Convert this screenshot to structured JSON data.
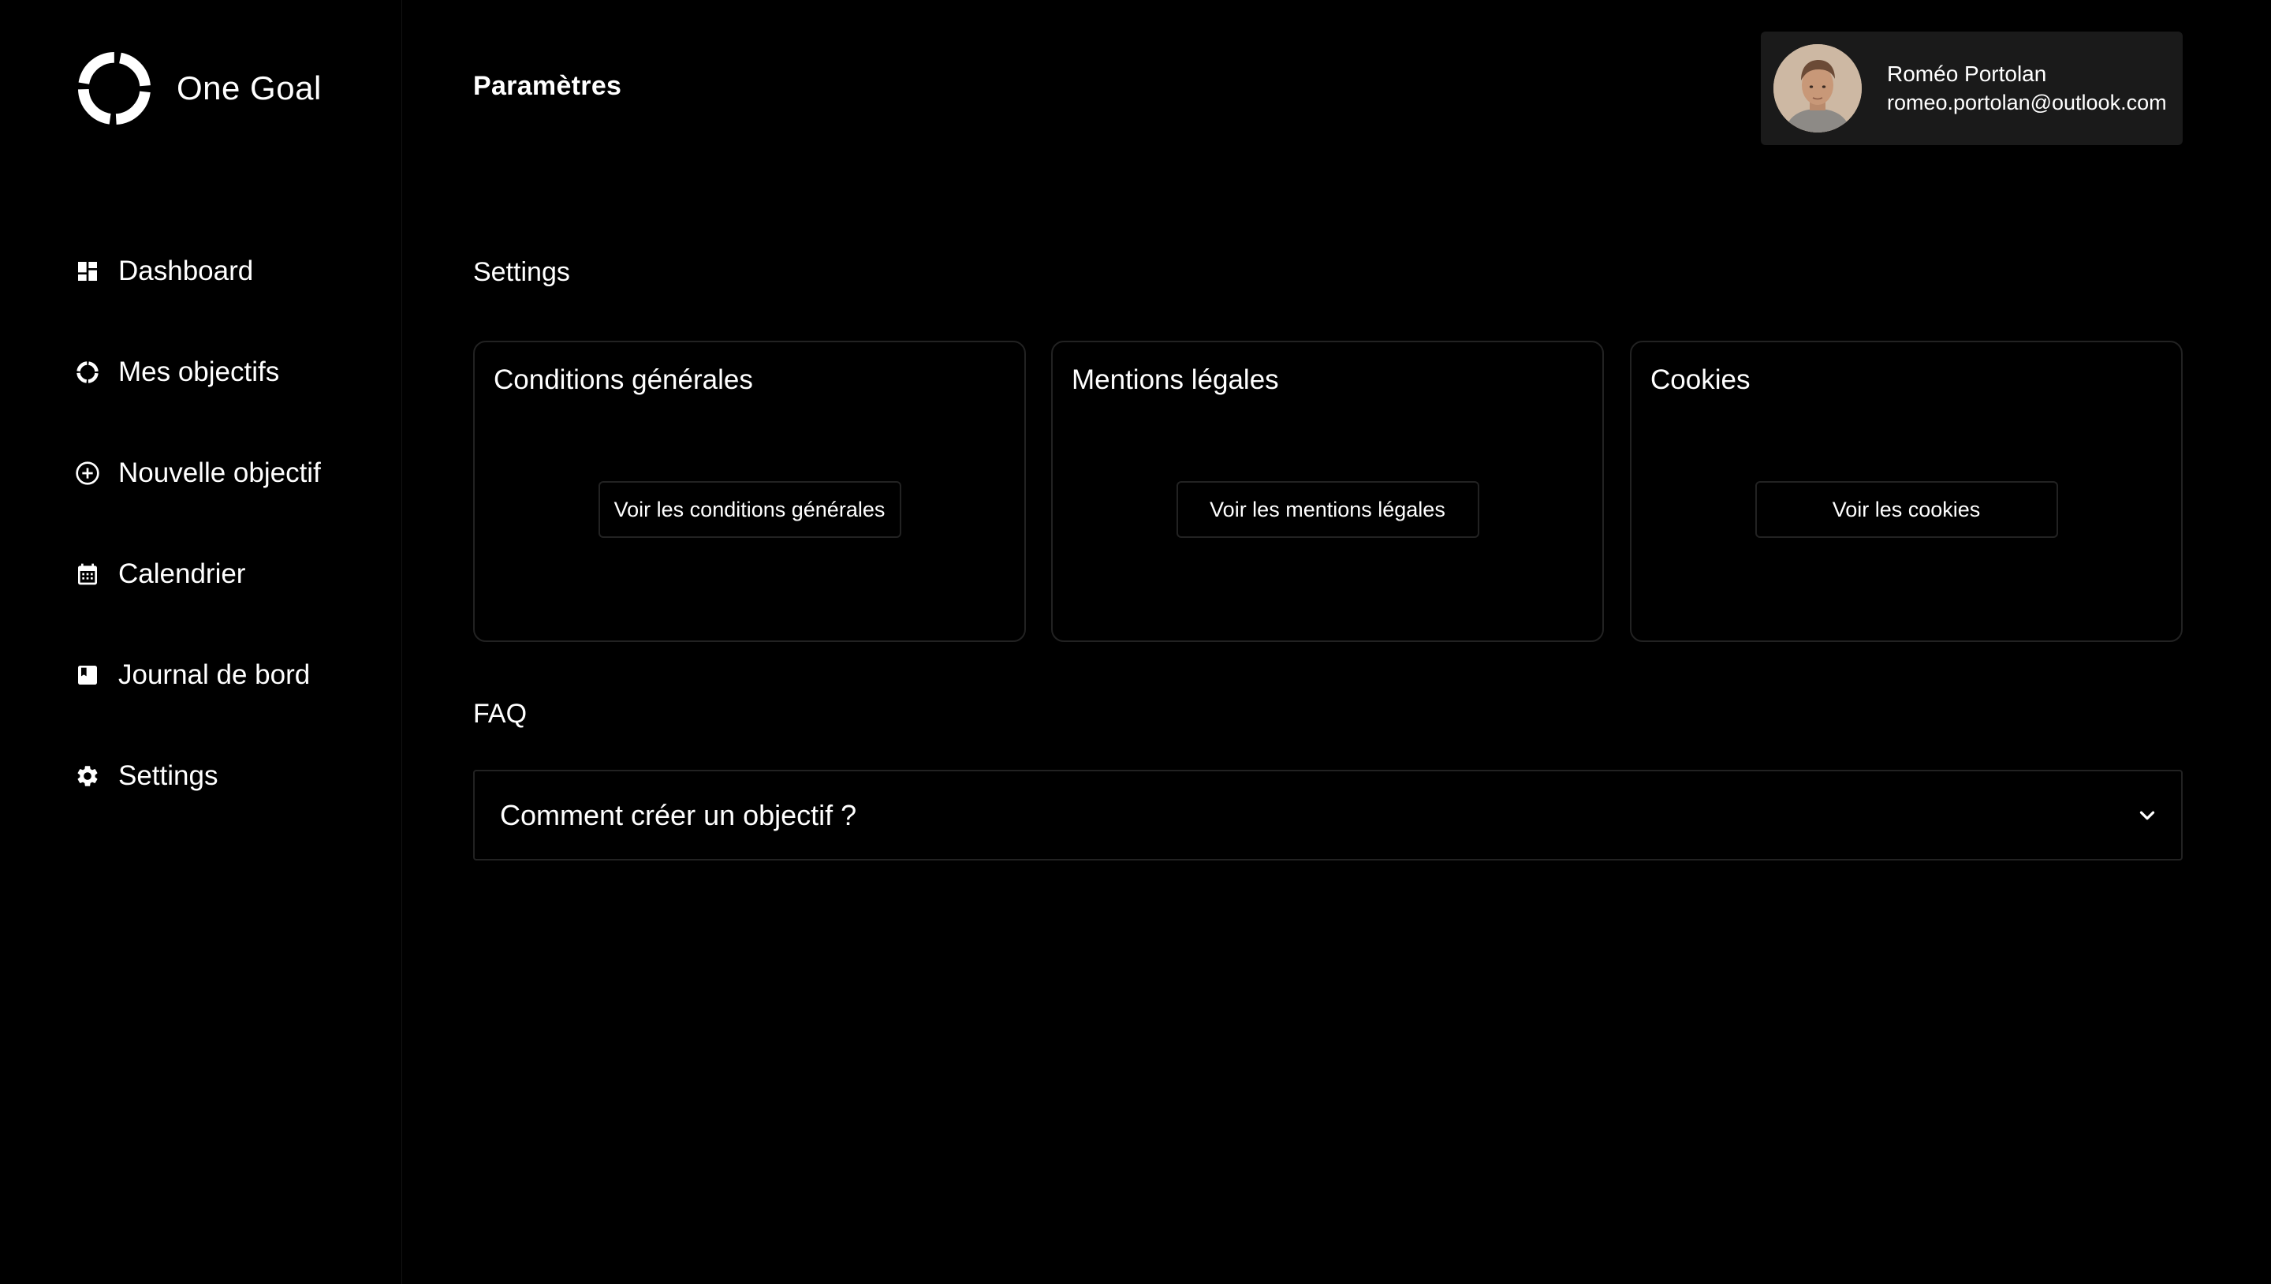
{
  "brand": {
    "name": "One Goal",
    "icon": "ring-logo-icon"
  },
  "sidebar": {
    "items": [
      {
        "label": "Dashboard",
        "icon": "dashboard-icon"
      },
      {
        "label": "Mes objectifs",
        "icon": "ring-icon"
      },
      {
        "label": "Nouvelle objectif",
        "icon": "add-circle-icon"
      },
      {
        "label": "Calendrier",
        "icon": "calendar-icon"
      },
      {
        "label": "Journal de bord",
        "icon": "book-icon"
      },
      {
        "label": "Settings",
        "icon": "gear-icon"
      }
    ]
  },
  "header": {
    "title": "Paramètres"
  },
  "user": {
    "name": "Roméo Portolan",
    "email": "romeo.portolan@outlook.com"
  },
  "settings": {
    "heading": "Settings",
    "cards": [
      {
        "title": "Conditions générales",
        "button": "Voir les conditions générales"
      },
      {
        "title": "Mentions légales",
        "button": "Voir les mentions légales"
      },
      {
        "title": "Cookies",
        "button": "Voir les cookies"
      }
    ]
  },
  "faq": {
    "heading": "FAQ",
    "items": [
      {
        "question": "Comment créer un objectif ?",
        "icon": "chevron-down-icon",
        "expanded": false
      }
    ]
  },
  "colors": {
    "background": "#000000",
    "text": "#ffffff",
    "card_border": "#222222",
    "user_card": "#1a1a1a"
  }
}
